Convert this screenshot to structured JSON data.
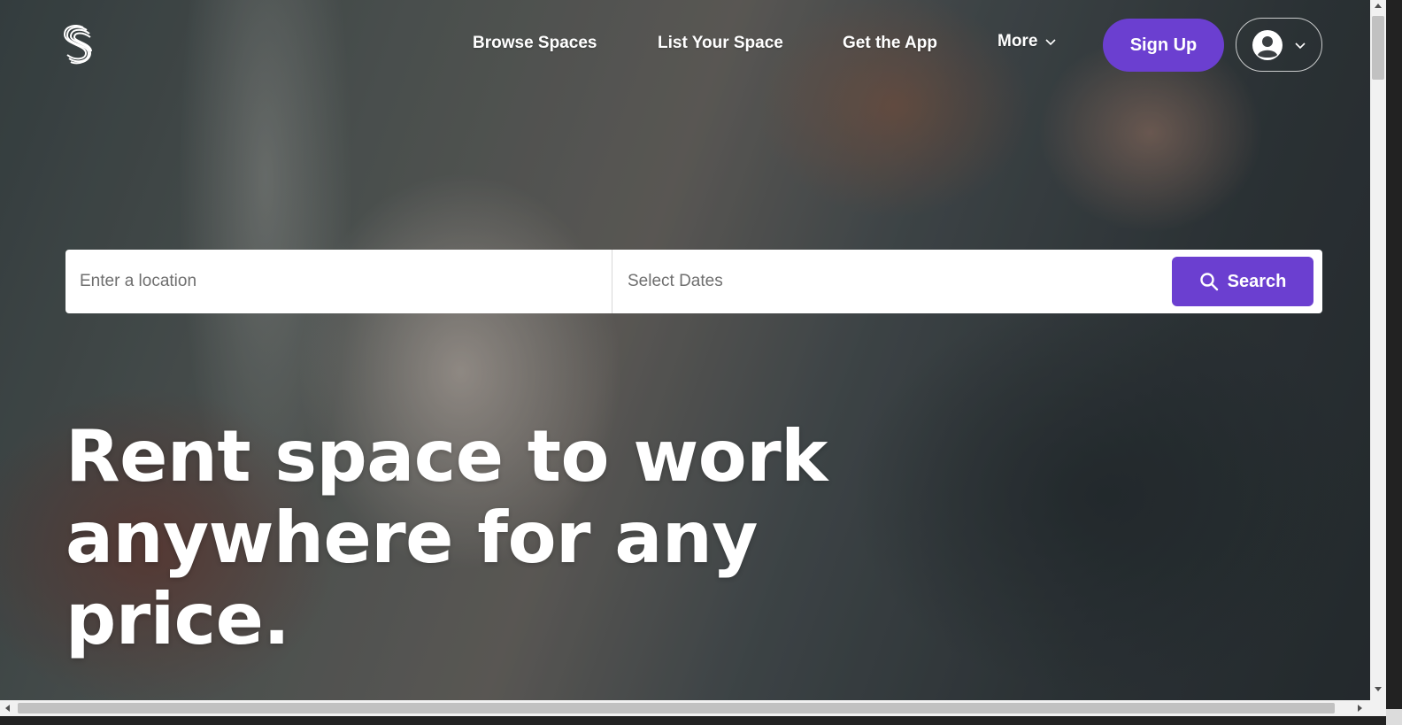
{
  "brand": {
    "logo_icon": "stylized-s-logo-icon",
    "accent_color": "#6b3fd0"
  },
  "nav": {
    "browse": "Browse Spaces",
    "list": "List Your Space",
    "app": "Get the App",
    "more": "More",
    "signup": "Sign Up",
    "account_icon": "user-circle-icon"
  },
  "search": {
    "location_placeholder": "Enter a location",
    "dates_placeholder": "Select Dates",
    "button_label": "Search",
    "button_icon": "search-icon"
  },
  "hero": {
    "headline": "Rent space to work anywhere for any price.",
    "background": "barber shaving client photo"
  }
}
